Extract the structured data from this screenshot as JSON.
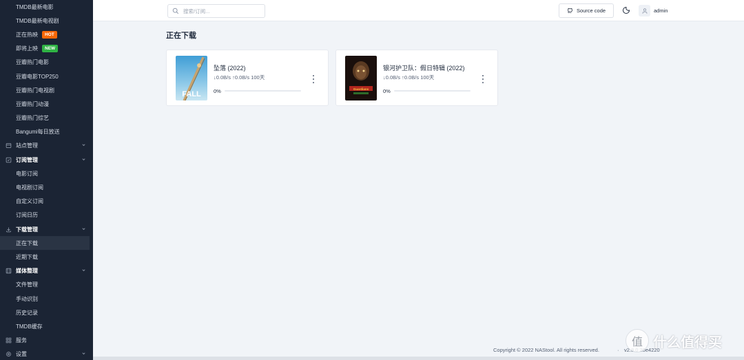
{
  "sidebar": {
    "items": [
      {
        "label": "TMDB最新电影",
        "kind": "sub"
      },
      {
        "label": "TMDB最新电视剧",
        "kind": "sub"
      },
      {
        "label": "正在热映",
        "kind": "sub",
        "badge": "HOT",
        "badge_color": "#f76707"
      },
      {
        "label": "即将上映",
        "kind": "sub",
        "badge": "NEW",
        "badge_color": "#2fb344"
      },
      {
        "label": "豆瓣热门电影",
        "kind": "sub"
      },
      {
        "label": "豆瓣电影TOP250",
        "kind": "sub"
      },
      {
        "label": "豆瓣热门电视剧",
        "kind": "sub"
      },
      {
        "label": "豆瓣热门动漫",
        "kind": "sub"
      },
      {
        "label": "豆瓣热门综艺",
        "kind": "sub"
      },
      {
        "label": "Bangumi每日放送",
        "kind": "sub"
      },
      {
        "label": "站点管理",
        "kind": "group",
        "icon": "site-icon",
        "chevron": true
      },
      {
        "label": "订阅管理",
        "kind": "group",
        "icon": "subscribe-icon",
        "chevron": true,
        "open": true
      },
      {
        "label": "电影订阅",
        "kind": "sub"
      },
      {
        "label": "电视剧订阅",
        "kind": "sub"
      },
      {
        "label": "自定义订阅",
        "kind": "sub"
      },
      {
        "label": "订阅日历",
        "kind": "sub"
      },
      {
        "label": "下载管理",
        "kind": "group",
        "icon": "download-icon",
        "chevron": true,
        "open": true
      },
      {
        "label": "正在下载",
        "kind": "sub",
        "active": true
      },
      {
        "label": "近期下载",
        "kind": "sub"
      },
      {
        "label": "媒体整理",
        "kind": "group",
        "icon": "media-icon",
        "chevron": true,
        "open": true
      },
      {
        "label": "文件管理",
        "kind": "sub"
      },
      {
        "label": "手动识别",
        "kind": "sub"
      },
      {
        "label": "历史记录",
        "kind": "sub"
      },
      {
        "label": "TMDB缓存",
        "kind": "sub"
      },
      {
        "label": "服务",
        "kind": "group",
        "icon": "service-icon"
      },
      {
        "label": "设置",
        "kind": "group",
        "icon": "settings-icon",
        "chevron": true
      }
    ]
  },
  "header": {
    "search_placeholder": "搜索/订阅...",
    "source_code_label": "Source code",
    "username": "admin"
  },
  "main": {
    "title": "正在下载",
    "downloads": [
      {
        "title": "坠落 (2022)",
        "speed": "↓0.0B/s ↑0.0B/s 100天",
        "progress_label": "0%",
        "progress": 0,
        "poster_text": "FALL"
      },
      {
        "title": "银河护卫队：假日特辑 (2022)",
        "speed": "↓0.0B/s ↑0.0B/s 100天",
        "progress_label": "0%",
        "progress": 0,
        "poster_text": "Guardians"
      }
    ]
  },
  "footer": {
    "copyright": "Copyright © 2022 NAStool. All rights reserved.",
    "separator": "·",
    "version": "v2.8.0 20e4220"
  },
  "watermark": {
    "text": "什么值得买",
    "circle": "值"
  },
  "colors": {
    "sidebar_bg": "#1b2434",
    "accent": "#206bc4",
    "hot": "#f76707",
    "new": "#2fb344"
  }
}
